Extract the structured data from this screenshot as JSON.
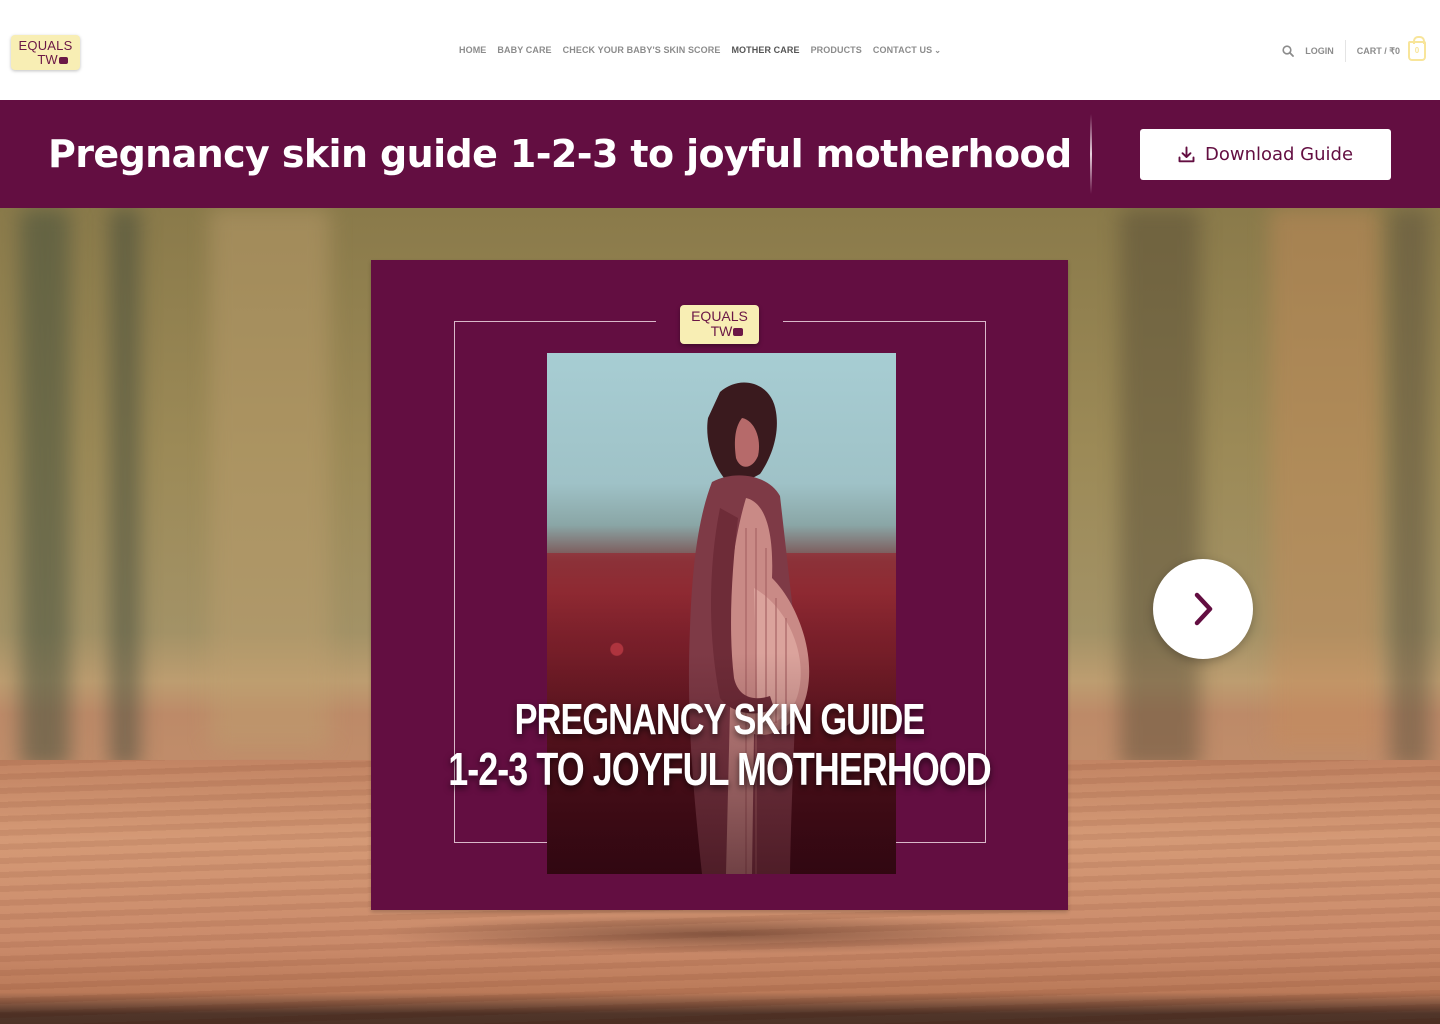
{
  "header": {
    "logo": {
      "line1": "EQUALS",
      "line2": "TW"
    },
    "nav": [
      {
        "label": "HOME",
        "active": false
      },
      {
        "label": "BABY CARE",
        "active": false
      },
      {
        "label": "CHECK YOUR BABY'S SKIN SCORE",
        "active": false
      },
      {
        "label": "MOTHER CARE",
        "active": true
      },
      {
        "label": "PRODUCTS",
        "active": false
      },
      {
        "label": "CONTACT US",
        "active": false,
        "has_dropdown": true
      }
    ],
    "right": {
      "search_icon": "search-icon",
      "login_label": "LOGIN",
      "cart_label": "CART / ₹0",
      "cart_count": "0"
    }
  },
  "banner": {
    "title": "Pregnancy skin guide 1-2-3 to joyful motherhood",
    "download_label": "Download Guide",
    "download_icon": "download-icon"
  },
  "hero": {
    "cover": {
      "logo": {
        "line1": "EQUALS",
        "line2": "TW"
      },
      "title_line1": "PREGNANCY SKIN GUIDE",
      "title_line2": "1-2-3 TO JOYFUL MOTHERHOOD"
    },
    "next_icon": "chevron-right-icon"
  },
  "colors": {
    "brand": "#630e41",
    "logo_bg": "#f8eeb4",
    "nav_text": "#8c8c8c",
    "cart_accent": "#f8e59a"
  }
}
